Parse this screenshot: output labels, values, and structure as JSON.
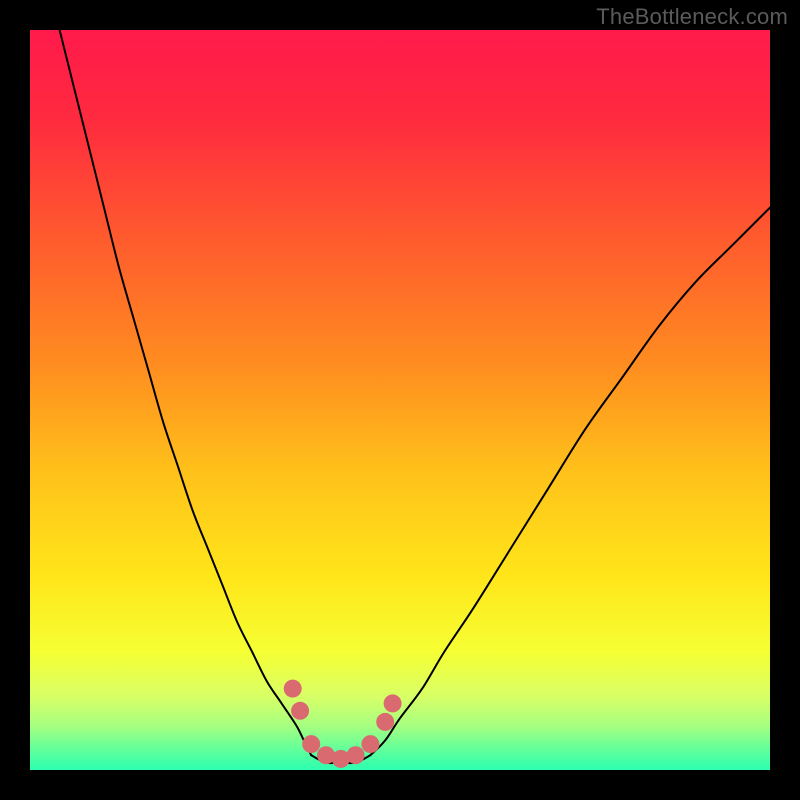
{
  "watermark": "TheBottleneck.com",
  "chart_data": {
    "type": "line",
    "title": "",
    "xlabel": "",
    "ylabel": "",
    "xlim": [
      0,
      100
    ],
    "ylim": [
      0,
      100
    ],
    "grid": false,
    "legend": false,
    "gradient_stops": [
      {
        "offset": 0.0,
        "color": "#ff1a4b"
      },
      {
        "offset": 0.12,
        "color": "#ff2a3f"
      },
      {
        "offset": 0.28,
        "color": "#ff5a2e"
      },
      {
        "offset": 0.45,
        "color": "#ff8c20"
      },
      {
        "offset": 0.6,
        "color": "#ffc21a"
      },
      {
        "offset": 0.74,
        "color": "#ffe61a"
      },
      {
        "offset": 0.84,
        "color": "#f5ff33"
      },
      {
        "offset": 0.9,
        "color": "#d9ff66"
      },
      {
        "offset": 0.94,
        "color": "#a6ff80"
      },
      {
        "offset": 0.97,
        "color": "#66ff99"
      },
      {
        "offset": 1.0,
        "color": "#2bffb0"
      }
    ],
    "series": [
      {
        "name": "left-curve",
        "x": [
          4,
          6,
          8,
          10,
          12,
          14,
          16,
          18,
          20,
          22,
          24,
          26,
          28,
          30,
          32,
          34,
          36,
          37,
          38
        ],
        "y": [
          100,
          92,
          84,
          76,
          68,
          61,
          54,
          47,
          41,
          35,
          30,
          25,
          20,
          16,
          12,
          9,
          6,
          4,
          2
        ]
      },
      {
        "name": "right-curve",
        "x": [
          46,
          48,
          50,
          53,
          56,
          60,
          65,
          70,
          75,
          80,
          85,
          90,
          95,
          100
        ],
        "y": [
          2,
          4,
          7,
          11,
          16,
          22,
          30,
          38,
          46,
          53,
          60,
          66,
          71,
          76
        ]
      },
      {
        "name": "valley-floor",
        "x": [
          38,
          40,
          42,
          44,
          46
        ],
        "y": [
          2,
          1,
          1,
          1,
          2
        ]
      }
    ],
    "markers": {
      "name": "highlight-dots",
      "color": "#d96a6f",
      "radius": 9,
      "points": [
        {
          "x": 35.5,
          "y": 11
        },
        {
          "x": 36.5,
          "y": 8
        },
        {
          "x": 38.0,
          "y": 3.5
        },
        {
          "x": 40.0,
          "y": 2
        },
        {
          "x": 42.0,
          "y": 1.5
        },
        {
          "x": 44.0,
          "y": 2
        },
        {
          "x": 46.0,
          "y": 3.5
        },
        {
          "x": 48.0,
          "y": 6.5
        },
        {
          "x": 49.0,
          "y": 9
        }
      ]
    }
  }
}
